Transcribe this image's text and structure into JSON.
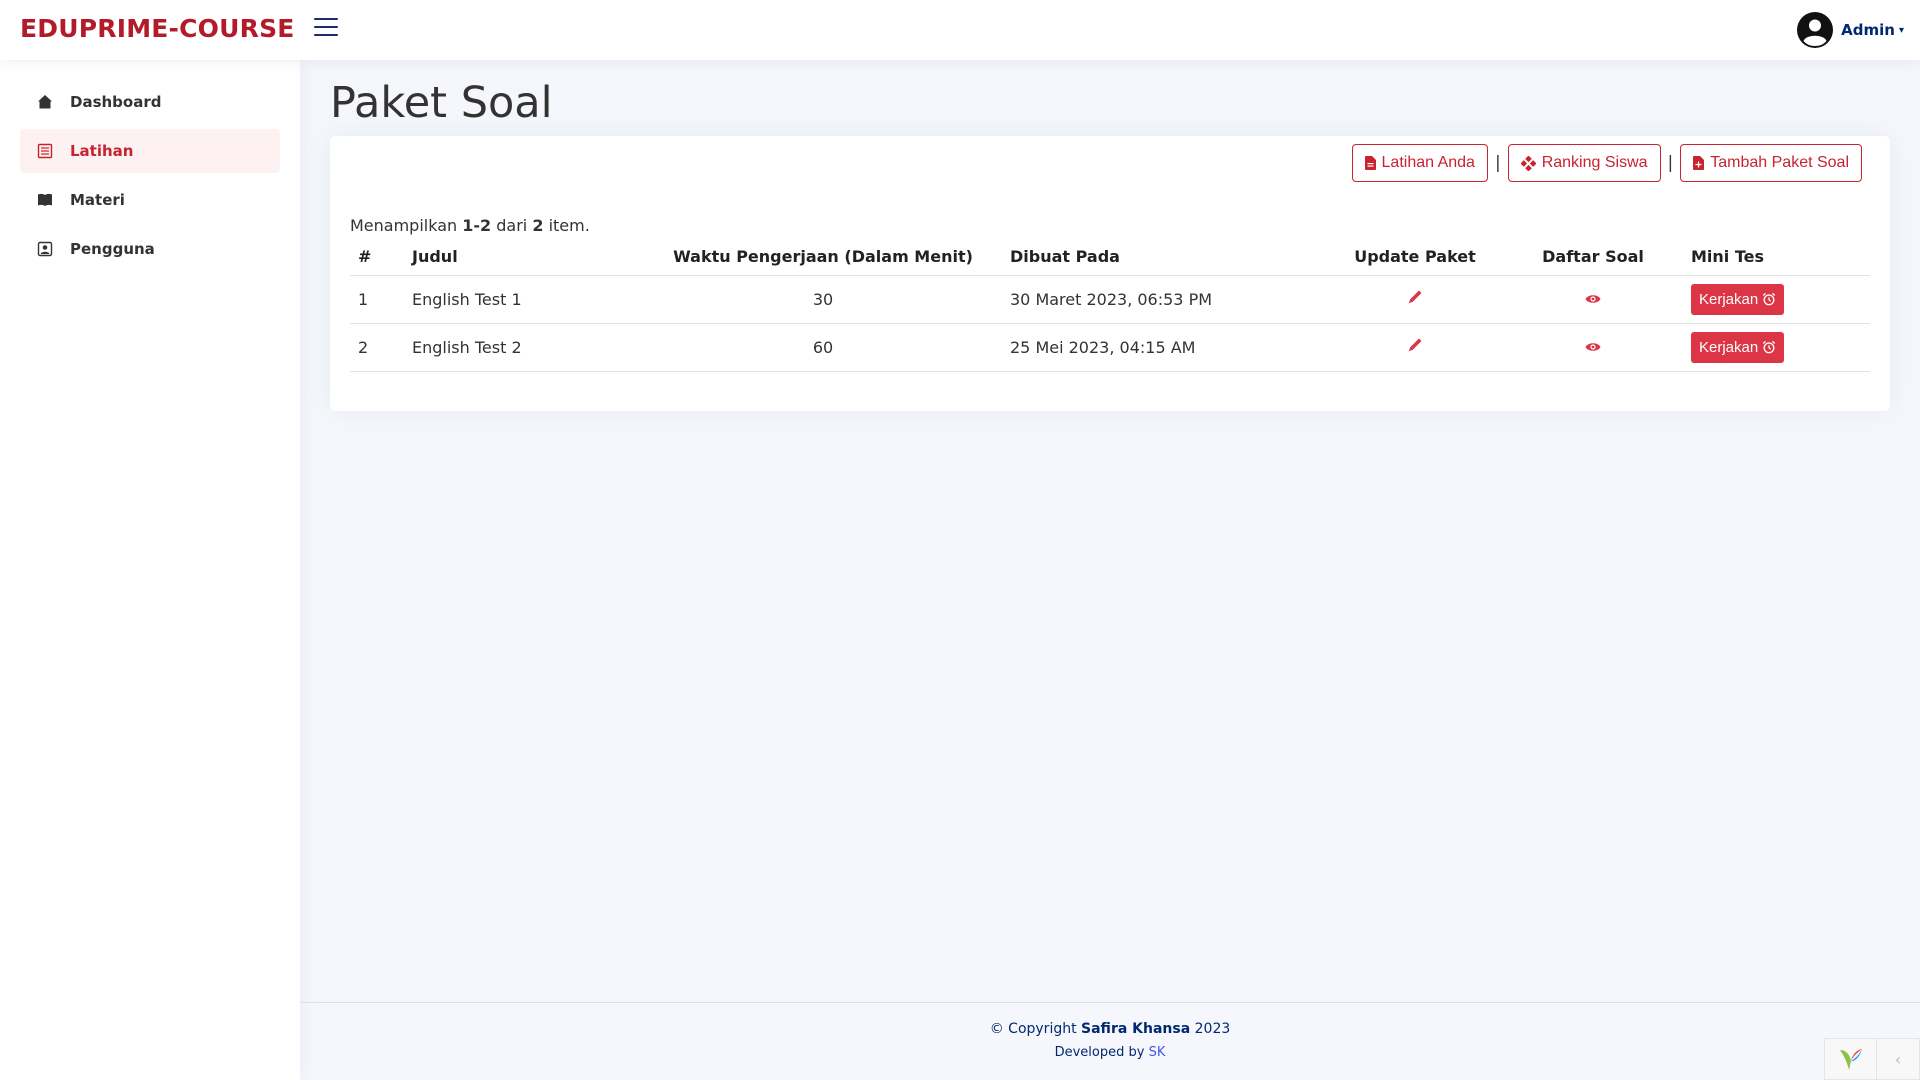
{
  "app": {
    "logo": "EDUPRIME-COURSE",
    "user_name": "Admin"
  },
  "sidebar": {
    "items": [
      {
        "label": "Dashboard",
        "icon": "home-icon",
        "active": false
      },
      {
        "label": "Latihan",
        "icon": "list-icon",
        "active": true
      },
      {
        "label": "Materi",
        "icon": "book-icon",
        "active": false
      },
      {
        "label": "Pengguna",
        "icon": "person-badge-icon",
        "active": false
      }
    ]
  },
  "page": {
    "title": "Paket Soal"
  },
  "actions": {
    "latihan_anda": "Latihan Anda",
    "ranking_siswa": "Ranking Siswa",
    "tambah_paket": "Tambah Paket Soal",
    "separator": "|"
  },
  "summary": {
    "prefix": "Menampilkan",
    "range": "1-2",
    "middle": "dari",
    "total": "2",
    "suffix": "item."
  },
  "table": {
    "headers": [
      "#",
      "Judul",
      "Waktu Pengerjaan (Dalam Menit)",
      "Dibuat Pada",
      "Update Paket",
      "Daftar Soal",
      "Mini Tes"
    ],
    "rows": [
      {
        "no": "1",
        "judul": "English Test 1",
        "waktu": "30",
        "dibuat": "30 Maret 2023, 06:53 PM",
        "action_label": "Kerjakan"
      },
      {
        "no": "2",
        "judul": "English Test 2",
        "waktu": "60",
        "dibuat": "25 Mei 2023, 04:15 AM",
        "action_label": "Kerjakan"
      }
    ]
  },
  "footer": {
    "copyright_prefix": "© Copyright",
    "author": "Safira Khansa",
    "year": "2023",
    "developed_by": "Developed by",
    "developer": "SK"
  },
  "colors": {
    "brand": "#b31b2b",
    "accent": "#c8232f",
    "button": "#dc3545",
    "navy": "#012970"
  }
}
